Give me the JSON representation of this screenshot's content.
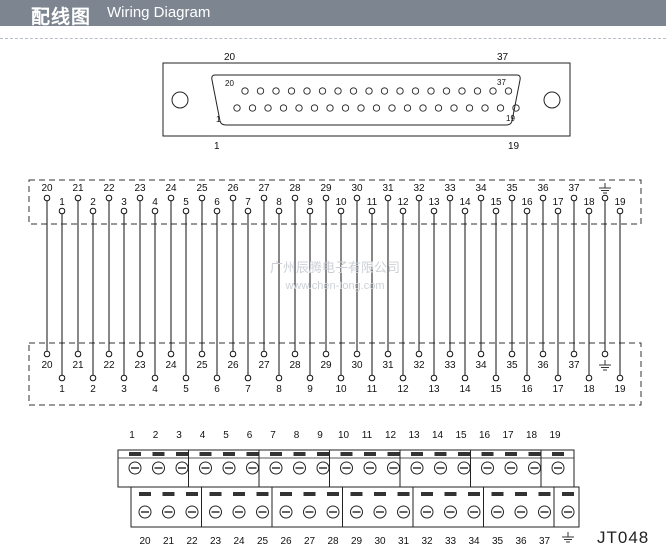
{
  "header": {
    "title_cn": "配线图",
    "title_en": "Wiring Diagram"
  },
  "model": "JT048",
  "connector": {
    "outer_top_left": "20",
    "outer_top_right": "37",
    "outer_bottom_left": "1",
    "outer_bottom_right": "19",
    "inner_top_left": "20",
    "inner_top_right": "37",
    "inner_bottom_left": "1",
    "inner_bottom_right": "19",
    "top_row_pin_count": 18,
    "bottom_row_pin_count": 19
  },
  "upper_row": {
    "top_labels": [
      "20",
      "21",
      "22",
      "23",
      "24",
      "25",
      "26",
      "27",
      "28",
      "29",
      "30",
      "31",
      "32",
      "33",
      "34",
      "35",
      "36",
      "37"
    ],
    "bottom_labels": [
      "1",
      "2",
      "3",
      "4",
      "5",
      "6",
      "7",
      "8",
      "9",
      "10",
      "11",
      "12",
      "13",
      "14",
      "15",
      "16",
      "17",
      "18",
      "19"
    ],
    "ground_icon": "ground-icon"
  },
  "lower_row": {
    "top_labels": [
      "20",
      "21",
      "22",
      "23",
      "24",
      "25",
      "26",
      "27",
      "28",
      "29",
      "30",
      "31",
      "32",
      "33",
      "34",
      "35",
      "36",
      "37"
    ],
    "bottom_labels": [
      "1",
      "2",
      "3",
      "4",
      "5",
      "6",
      "7",
      "8",
      "9",
      "10",
      "11",
      "12",
      "13",
      "14",
      "15",
      "16",
      "17",
      "18",
      "19"
    ],
    "ground_icon": "ground-icon"
  },
  "terminal_block": {
    "top_labels": [
      "1",
      "2",
      "3",
      "4",
      "5",
      "6",
      "7",
      "8",
      "9",
      "10",
      "11",
      "12",
      "13",
      "14",
      "15",
      "16",
      "17",
      "18",
      "19"
    ],
    "bottom_labels": [
      "20",
      "21",
      "22",
      "23",
      "24",
      "25",
      "26",
      "27",
      "28",
      "29",
      "30",
      "31",
      "32",
      "33",
      "34",
      "35",
      "36",
      "37"
    ],
    "ground_icon": "ground-icon"
  },
  "watermark": {
    "line1": "广州辰腾电子有限公司",
    "line2": "www.chen-tong.com"
  }
}
